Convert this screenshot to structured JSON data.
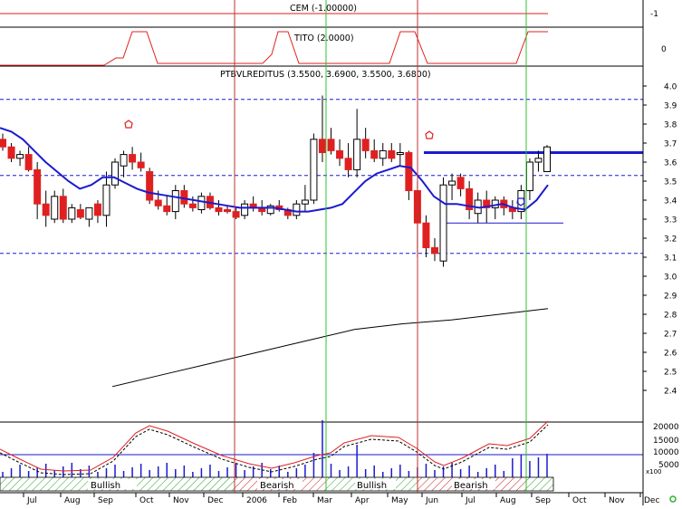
{
  "chart_data": {
    "type": "candlestick",
    "title": "PTBVLREDITUS (3.5500, 3.6900, 3.5500, 3.6800)",
    "indicators": {
      "cem": {
        "label": "CEM (-1.00000)",
        "value": -1,
        "axis_ticks": [
          "-1"
        ]
      },
      "tito": {
        "label": "TITO (2.0000)",
        "value": 2,
        "axis_ticks": [
          "0"
        ]
      }
    },
    "ylim": [
      2.3,
      4.05
    ],
    "yticks": [
      2.4,
      2.5,
      2.6,
      2.7,
      2.8,
      2.9,
      3.0,
      3.1,
      3.2,
      3.3,
      3.4,
      3.5,
      3.6,
      3.7,
      3.8,
      3.9,
      4.0
    ],
    "x_labels": [
      "Jul",
      "Aug",
      "Sep",
      "Oct",
      "Nov",
      "Dec",
      "2006",
      "Feb",
      "Mar",
      "Apr",
      "May",
      "Jun",
      "Jul",
      "Aug",
      "Sep",
      "Oct",
      "Nov",
      "Dec"
    ],
    "volume_ticks": [
      "20000",
      "15000",
      "10000",
      "5000"
    ],
    "volume_unit": "x100",
    "trend_bands": [
      "Bullish",
      "Bearish",
      "Bullish",
      "Bearish"
    ],
    "horizontal_levels": [
      3.93,
      3.53,
      3.12
    ],
    "resistance_level": 3.65,
    "support_level": 3.28,
    "weekly_ohlc": [
      [
        3.72,
        3.75,
        3.66,
        3.68
      ],
      [
        3.68,
        3.7,
        3.6,
        3.62
      ],
      [
        3.62,
        3.66,
        3.58,
        3.64
      ],
      [
        3.64,
        3.68,
        3.55,
        3.56
      ],
      [
        3.56,
        3.6,
        3.3,
        3.38
      ],
      [
        3.38,
        3.45,
        3.26,
        3.32
      ],
      [
        3.3,
        3.45,
        3.28,
        3.42
      ],
      [
        3.42,
        3.46,
        3.28,
        3.3
      ],
      [
        3.3,
        3.38,
        3.28,
        3.36
      ],
      [
        3.35,
        3.38,
        3.3,
        3.31
      ],
      [
        3.3,
        3.36,
        3.26,
        3.36
      ],
      [
        3.38,
        3.4,
        3.28,
        3.32
      ],
      [
        3.32,
        3.55,
        3.26,
        3.48
      ],
      [
        3.48,
        3.62,
        3.46,
        3.6
      ],
      [
        3.58,
        3.66,
        3.52,
        3.64
      ],
      [
        3.64,
        3.68,
        3.56,
        3.6
      ],
      [
        3.6,
        3.65,
        3.55,
        3.57
      ],
      [
        3.55,
        3.57,
        3.38,
        3.4
      ],
      [
        3.4,
        3.45,
        3.35,
        3.37
      ],
      [
        3.37,
        3.42,
        3.32,
        3.34
      ],
      [
        3.34,
        3.48,
        3.3,
        3.45
      ],
      [
        3.45,
        3.48,
        3.36,
        3.38
      ],
      [
        3.38,
        3.42,
        3.34,
        3.36
      ],
      [
        3.35,
        3.44,
        3.33,
        3.42
      ],
      [
        3.42,
        3.44,
        3.35,
        3.36
      ],
      [
        3.36,
        3.4,
        3.32,
        3.34
      ],
      [
        3.35,
        3.37,
        3.33,
        3.34
      ],
      [
        3.34,
        3.36,
        3.3,
        3.31
      ],
      [
        3.32,
        3.4,
        3.3,
        3.38
      ],
      [
        3.38,
        3.42,
        3.34,
        3.36
      ],
      [
        3.36,
        3.4,
        3.32,
        3.34
      ],
      [
        3.33,
        3.38,
        3.32,
        3.37
      ],
      [
        3.37,
        3.4,
        3.34,
        3.35
      ],
      [
        3.35,
        3.36,
        3.3,
        3.32
      ],
      [
        3.32,
        3.4,
        3.3,
        3.38
      ],
      [
        3.38,
        3.48,
        3.34,
        3.4
      ],
      [
        3.4,
        3.75,
        3.38,
        3.72
      ],
      [
        3.72,
        3.95,
        3.6,
        3.65
      ],
      [
        3.72,
        3.78,
        3.64,
        3.66
      ],
      [
        3.66,
        3.72,
        3.58,
        3.62
      ],
      [
        3.62,
        3.7,
        3.52,
        3.56
      ],
      [
        3.56,
        3.88,
        3.52,
        3.72
      ],
      [
        3.72,
        3.78,
        3.62,
        3.66
      ],
      [
        3.66,
        3.72,
        3.6,
        3.62
      ],
      [
        3.62,
        3.7,
        3.58,
        3.66
      ],
      [
        3.66,
        3.7,
        3.6,
        3.62
      ],
      [
        3.64,
        3.7,
        3.58,
        3.65
      ],
      [
        3.65,
        3.66,
        3.4,
        3.45
      ],
      [
        3.45,
        3.5,
        3.1,
        3.28
      ],
      [
        3.28,
        3.32,
        3.1,
        3.15
      ],
      [
        3.15,
        3.2,
        3.08,
        3.12
      ],
      [
        3.08,
        3.52,
        3.05,
        3.48
      ],
      [
        3.48,
        3.54,
        3.4,
        3.5
      ],
      [
        3.52,
        3.54,
        3.42,
        3.46
      ],
      [
        3.46,
        3.5,
        3.3,
        3.35
      ],
      [
        3.33,
        3.44,
        3.28,
        3.4
      ],
      [
        3.4,
        3.45,
        3.28,
        3.36
      ],
      [
        3.36,
        3.42,
        3.3,
        3.4
      ],
      [
        3.4,
        3.42,
        3.32,
        3.36
      ],
      [
        3.36,
        3.4,
        3.3,
        3.34
      ],
      [
        3.34,
        3.48,
        3.3,
        3.45
      ],
      [
        3.45,
        3.62,
        3.4,
        3.6
      ],
      [
        3.6,
        3.66,
        3.55,
        3.62
      ],
      [
        3.55,
        3.69,
        3.55,
        3.68
      ]
    ],
    "moving_average": [
      3.78,
      3.76,
      3.72,
      3.66,
      3.6,
      3.55,
      3.5,
      3.46,
      3.48,
      3.52,
      3.52,
      3.49,
      3.46,
      3.44,
      3.43,
      3.42,
      3.41,
      3.4,
      3.39,
      3.38,
      3.37,
      3.36,
      3.36,
      3.36,
      3.36,
      3.35,
      3.34,
      3.34,
      3.35,
      3.36,
      3.38,
      3.44,
      3.5,
      3.54,
      3.56,
      3.58,
      3.57,
      3.5,
      3.42,
      3.38,
      3.38,
      3.37,
      3.36,
      3.37,
      3.38,
      3.36,
      3.35,
      3.4,
      3.48
    ],
    "long_average": [
      2.42,
      2.48,
      2.54,
      2.6,
      2.66,
      2.72,
      2.75,
      2.77,
      2.8,
      2.83
    ]
  }
}
